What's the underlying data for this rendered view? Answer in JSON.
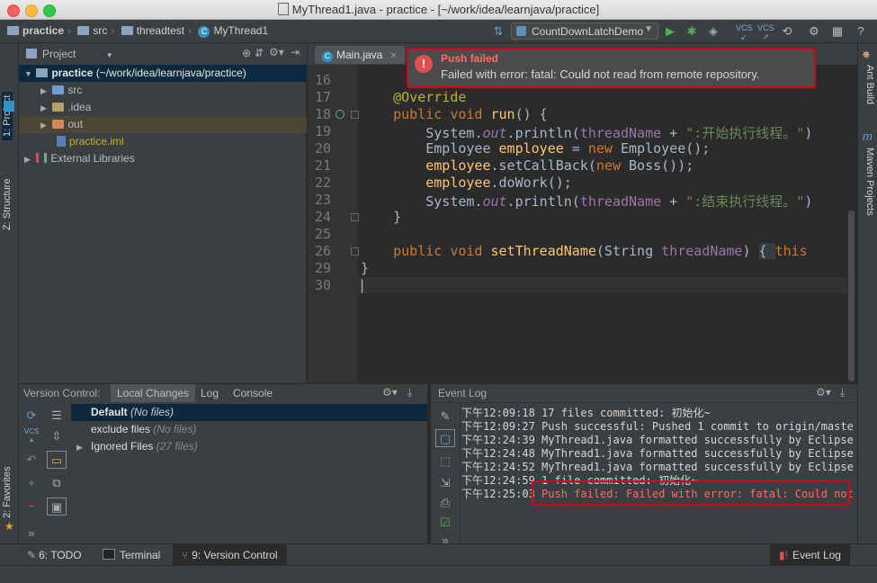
{
  "window": {
    "title": "MyThread1.java - practice - [~/work/idea/learnjava/practice]"
  },
  "navbar": {
    "crumbs": [
      "practice",
      "src",
      "threadtest",
      "MyThread1"
    ],
    "run_config": "CountDownLatchDemo"
  },
  "left_strip": {
    "project_tab": "1: Project",
    "structure_tab": "Z: Structure",
    "favorites_tab": "2: Favorites"
  },
  "right_strip": {
    "ant_tab": "Ant Build",
    "maven_tab": "Maven Projects"
  },
  "project": {
    "view_label": "Project",
    "tree": [
      {
        "label": "practice",
        "suffix": " (~/work/idea/learnjava/practice)"
      },
      {
        "label": "src"
      },
      {
        "label": ".idea"
      },
      {
        "label": "out"
      },
      {
        "label": "practice.iml"
      },
      {
        "label": "External Libraries"
      }
    ]
  },
  "editor": {
    "tab": "Main.java",
    "line_numbers": [
      "16",
      "17",
      "18",
      "19",
      "20",
      "21",
      "22",
      "23",
      "24",
      "25",
      "26",
      "29",
      "30"
    ]
  },
  "notification": {
    "title": "Push failed",
    "message": "Failed with error: fatal: Could not read from remote repository."
  },
  "version_control": {
    "header_label": "Version Control:",
    "tabs": [
      "Local Changes",
      "Log",
      "Console"
    ],
    "lists": [
      {
        "name": "Default",
        "count": "(No files)"
      },
      {
        "name": "exclude files",
        "count": "(No files)"
      },
      {
        "name": "Ignored Files",
        "count": "(27 files)"
      }
    ]
  },
  "event_log": {
    "title": "Event Log",
    "entries": [
      {
        "time": "下午12:09:18",
        "text": " 17 files committed: 初始化~"
      },
      {
        "time": "下午12:09:27",
        "text": " Push successful: Pushed 1 commit to origin/maste"
      },
      {
        "time": "下午12:24:39",
        "text": " MyThread1.java formatted successfully by Eclipse"
      },
      {
        "time": "下午12:24:48",
        "text": " MyThread1.java formatted successfully by Eclipse"
      },
      {
        "time": "下午12:24:52",
        "text": " MyThread1.java formatted successfully by Eclipse"
      },
      {
        "time": "下午12:24:59",
        "text": " 1 file committed: 初始化~"
      },
      {
        "time": "下午12:25:03",
        "text": " Push failed: Failed with error: fatal: Could not"
      }
    ]
  },
  "bottom_tabs": {
    "todo": "6: TODO",
    "terminal": "Terminal",
    "vcs": "9: Version Control",
    "event_log": "Event Log"
  },
  "colors": {
    "error_red": "#d0021b",
    "selection_blue": "#0d293e",
    "error_text": "#ff6b68"
  }
}
